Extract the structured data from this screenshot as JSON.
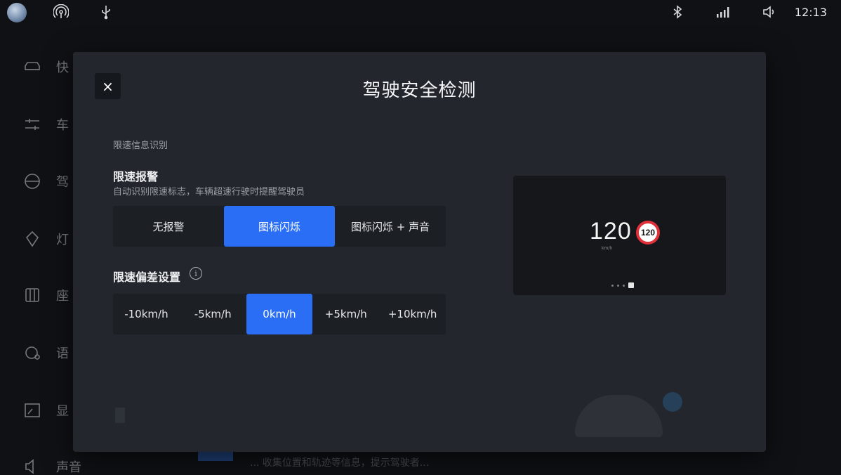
{
  "status_bar": {
    "icons_left": [
      "avatar",
      "hotspot-icon",
      "usb-icon"
    ],
    "icons_right": [
      "bluetooth-icon",
      "signal-icon",
      "volume-icon"
    ],
    "time": "12:13"
  },
  "sidebar": {
    "items": [
      {
        "icon": "car-icon",
        "label": "快"
      },
      {
        "icon": "sliders-icon",
        "label": "车"
      },
      {
        "icon": "steering-wheel-icon",
        "label": "驾"
      },
      {
        "icon": "light-icon",
        "label": "灯"
      },
      {
        "icon": "seat-icon",
        "label": "座"
      },
      {
        "icon": "voice-icon",
        "label": "语"
      },
      {
        "icon": "display-icon",
        "label": "显"
      },
      {
        "icon": "sound-icon",
        "label": "声音"
      }
    ]
  },
  "background": {
    "bottom_text": "... 收集位置和轨迹等信息，提示驾驶者..."
  },
  "modal": {
    "title": "驾驶安全检测",
    "close_label": "×",
    "section_label": "限速信息识别",
    "speed_alarm": {
      "title": "限速报警",
      "description": "自动识别限速标志，车辆超速行驶时提醒驾驶员",
      "options": [
        "无报警",
        "图标闪烁",
        "图标闪烁 + 声音"
      ],
      "selected": "图标闪烁"
    },
    "speed_offset": {
      "title": "限速偏差设置",
      "info_icon": "i",
      "options": [
        "-10km/h",
        "-5km/h",
        "0km/h",
        "+5km/h",
        "+10km/h"
      ],
      "selected": "0km/h"
    },
    "preview": {
      "speed": "120",
      "unit": "km/h",
      "sign_value": "120"
    }
  },
  "colors": {
    "accent": "#2a6ef5",
    "modal_bg": "#23272d",
    "page_bg": "#0f1114",
    "sign_red": "#e0303a"
  }
}
